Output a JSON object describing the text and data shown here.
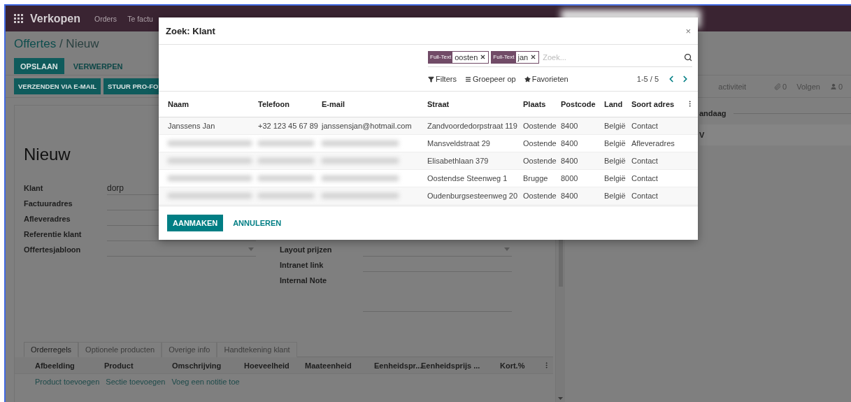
{
  "navbar": {
    "app": "Verkopen",
    "menu": [
      "Orders",
      "Te factu"
    ]
  },
  "breadcrumb": {
    "parent": "Offertes",
    "separator": "/",
    "current": "Nieuw"
  },
  "form_buttons": [
    {
      "label": "OPSLAAN",
      "primary": true
    },
    {
      "label": "VERWERPEN",
      "primary": false
    }
  ],
  "status_buttons": [
    "VERZENDEN VIA E-MAIL",
    "STUUR PRO-FO"
  ],
  "chatter": {
    "activity": "activiteit",
    "attachments": "0",
    "follow": "Volgen",
    "followers": "0",
    "date_separator": "andaag",
    "message_initial": "V"
  },
  "form": {
    "title": "Nieuw",
    "left_fields": [
      {
        "label": "Klant",
        "value": "dorp",
        "kind": "text"
      },
      {
        "label": "Factuuradres",
        "kind": "text"
      },
      {
        "label": "Afleveradres",
        "kind": "text"
      },
      {
        "label": "Referentie klant",
        "kind": "text"
      },
      {
        "label": "Offertesjabloon",
        "kind": "select"
      }
    ],
    "right_fields": [
      {
        "label": "Layout prijzen",
        "kind": "select"
      },
      {
        "label": "Intranet link",
        "kind": "text"
      },
      {
        "label": "Internal Note",
        "kind": "note"
      }
    ]
  },
  "tabs": [
    {
      "label": "Orderregels",
      "selected": true
    },
    {
      "label": "Optionele producten",
      "selected": false
    },
    {
      "label": "Overige info",
      "selected": false
    },
    {
      "label": "Handtekening klant",
      "selected": false
    }
  ],
  "order_columns": [
    "Afbeelding",
    "Product",
    "Omschrijving",
    "Hoeveelheid",
    "Maateenheid",
    "Eenheidspr...",
    "Eenheidsprijs ...",
    "Kort.%"
  ],
  "order_links": [
    "Product toevoegen",
    "Sectie toevoegen",
    "Voeg een notitie toe"
  ],
  "dialog": {
    "title": "Zoek: Klant",
    "close": "×",
    "facets": [
      {
        "label": "Full-Text",
        "value": "oosten"
      },
      {
        "label": "Full-Text",
        "value": "jan"
      }
    ],
    "search_placeholder": "Zoek...",
    "filters": [
      "Filters",
      "Groepeer op",
      "Favorieten"
    ],
    "pager": "1-5 / 5",
    "columns": [
      "Naam",
      "Telefoon",
      "E-mail",
      "Straat",
      "Plaats",
      "Postcode",
      "Land",
      "Soort adres"
    ],
    "rows": [
      {
        "naam": "Janssens Jan",
        "telefoon": "+32 123 45 67 89",
        "email": "janssensjan@hotmail.com",
        "straat": "Zandvoordedorpstraat 119",
        "plaats": "Oostende",
        "postcode": "8400",
        "land": "België",
        "soort": "Contact"
      },
      {
        "straat": "Mansveldstraat 29",
        "plaats": "Oostende",
        "postcode": "8400",
        "land": "België",
        "soort": "Afleveradres"
      },
      {
        "straat": "Elisabethlaan 379",
        "plaats": "Oostende",
        "postcode": "8400",
        "land": "België",
        "soort": "Contact"
      },
      {
        "straat": "Oostendse Steenweg 1",
        "plaats": "Brugge",
        "postcode": "8000",
        "land": "België",
        "soort": "Contact"
      },
      {
        "straat": "Oudenburgsesteenweg 20",
        "plaats": "Oostende",
        "postcode": "8400",
        "land": "België",
        "soort": "Contact"
      }
    ],
    "buttons": [
      {
        "label": "AANMAKEN",
        "primary": true
      },
      {
        "label": "ANNULEREN",
        "primary": false
      }
    ]
  }
}
